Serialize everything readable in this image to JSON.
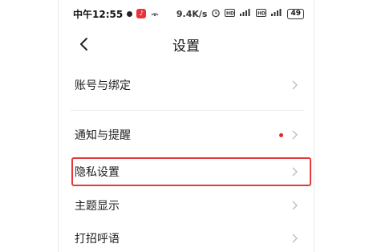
{
  "status_bar": {
    "time": "中午12:55",
    "app_badge": "♪",
    "speed": "9.4K/s",
    "battery": "49"
  },
  "nav": {
    "title": "设置"
  },
  "settings": {
    "items": [
      {
        "label": "账号与绑定"
      },
      {
        "label": "通知与提醒",
        "has_dot": true
      },
      {
        "label": "隐私设置",
        "highlighted": true
      },
      {
        "label": "主题显示"
      },
      {
        "label": "打招呼语"
      }
    ]
  },
  "colors": {
    "highlight": "#e23a3a",
    "notification_dot": "#e5262b"
  }
}
